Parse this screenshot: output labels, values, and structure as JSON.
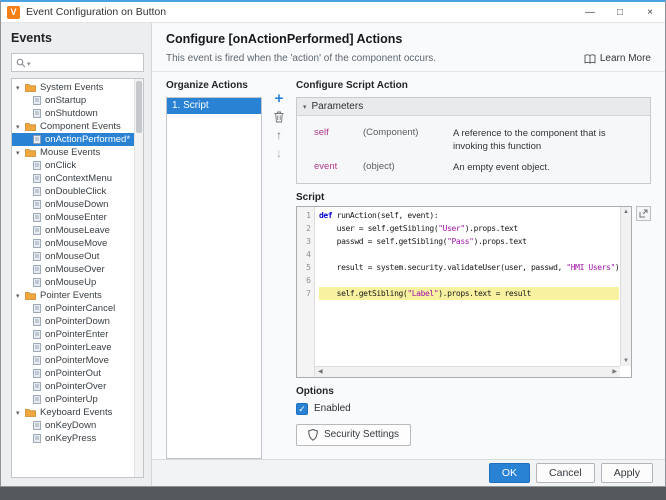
{
  "window": {
    "title": "Event Configuration on Button"
  },
  "icons": {
    "app_logo_letter": "V",
    "minimize": "—",
    "maximize": "□",
    "close": "×",
    "chevron_down": "▾",
    "plus": "+",
    "arrow_up": "↑",
    "arrow_down": "↓",
    "scroll_up": "▲",
    "scroll_down": "▼",
    "scroll_left": "◀",
    "scroll_right": "▶",
    "check": "✓"
  },
  "colors": {
    "accent": "#2a82d4",
    "selection": "#2a82d4",
    "line_highlight": "#f8f2a0",
    "keyword": "#0000cc",
    "string": "#a216a8",
    "param_name": "#b03a8c",
    "folder_icon": "#f0a73e"
  },
  "sidebar": {
    "heading": "Events",
    "search": {
      "placeholder": "",
      "value": ""
    },
    "tree": [
      {
        "type": "folder",
        "label": "System Events"
      },
      {
        "type": "leaf",
        "label": "onStartup"
      },
      {
        "type": "leaf",
        "label": "onShutdown"
      },
      {
        "type": "folder",
        "label": "Component Events"
      },
      {
        "type": "leaf",
        "label": "onActionPerformed*",
        "selected": true
      },
      {
        "type": "folder",
        "label": "Mouse Events"
      },
      {
        "type": "leaf",
        "label": "onClick"
      },
      {
        "type": "leaf",
        "label": "onContextMenu"
      },
      {
        "type": "leaf",
        "label": "onDoubleClick"
      },
      {
        "type": "leaf",
        "label": "onMouseDown"
      },
      {
        "type": "leaf",
        "label": "onMouseEnter"
      },
      {
        "type": "leaf",
        "label": "onMouseLeave"
      },
      {
        "type": "leaf",
        "label": "onMouseMove"
      },
      {
        "type": "leaf",
        "label": "onMouseOut"
      },
      {
        "type": "leaf",
        "label": "onMouseOver"
      },
      {
        "type": "leaf",
        "label": "onMouseUp"
      },
      {
        "type": "folder",
        "label": "Pointer Events"
      },
      {
        "type": "leaf",
        "label": "onPointerCancel"
      },
      {
        "type": "leaf",
        "label": "onPointerDown"
      },
      {
        "type": "leaf",
        "label": "onPointerEnter"
      },
      {
        "type": "leaf",
        "label": "onPointerLeave"
      },
      {
        "type": "leaf",
        "label": "onPointerMove"
      },
      {
        "type": "leaf",
        "label": "onPointerOut"
      },
      {
        "type": "leaf",
        "label": "onPointerOver"
      },
      {
        "type": "leaf",
        "label": "onPointerUp"
      },
      {
        "type": "folder",
        "label": "Keyboard Events"
      },
      {
        "type": "leaf",
        "label": "onKeyDown"
      },
      {
        "type": "leaf",
        "label": "onKeyPress"
      }
    ]
  },
  "main": {
    "title": "Configure [onActionPerformed] Actions",
    "subtitle": "This event is fired when the 'action' of the component occurs.",
    "learn_more": "Learn More",
    "organize": {
      "heading": "Organize Actions",
      "items": [
        {
          "label": "1. Script",
          "selected": true
        }
      ]
    },
    "script_action": {
      "heading": "Configure Script Action",
      "parameters": {
        "heading": "Parameters",
        "rows": [
          {
            "name": "self",
            "type": "(Component)",
            "description": "A reference to the component that is invoking this function"
          },
          {
            "name": "event",
            "type": "(object)",
            "description": "An empty event object."
          }
        ]
      },
      "script_label": "Script",
      "code": {
        "lines": [
          {
            "tokens": [
              {
                "t": "kw",
                "v": "def"
              },
              {
                "t": "pl",
                "v": " runAction(self, event):"
              }
            ]
          },
          {
            "tokens": [
              {
                "t": "pl",
                "v": "    user = self.getSibling("
              },
              {
                "t": "str",
                "v": "\"User\""
              },
              {
                "t": "pl",
                "v": ").props.text"
              }
            ]
          },
          {
            "tokens": [
              {
                "t": "pl",
                "v": "    passwd = self.getSibling("
              },
              {
                "t": "str",
                "v": "\"Pass\""
              },
              {
                "t": "pl",
                "v": ").props.text"
              }
            ]
          },
          {
            "tokens": []
          },
          {
            "tokens": [
              {
                "t": "pl",
                "v": "    result = system.security.validateUser(user, passwd, "
              },
              {
                "t": "str",
                "v": "\"HMI Users\""
              },
              {
                "t": "pl",
                "v": ")"
              }
            ]
          },
          {
            "tokens": []
          },
          {
            "tokens": [
              {
                "t": "pl",
                "v": "    self.getSibling("
              },
              {
                "t": "str",
                "v": "\"Label\""
              },
              {
                "t": "pl",
                "v": ").props.text = result"
              }
            ],
            "highlight": true
          }
        ]
      },
      "options": {
        "heading": "Options",
        "enabled_label": "Enabled",
        "enabled_checked": true,
        "security_button": "Security Settings"
      }
    },
    "footer": {
      "ok": "OK",
      "cancel": "Cancel",
      "apply": "Apply"
    }
  }
}
